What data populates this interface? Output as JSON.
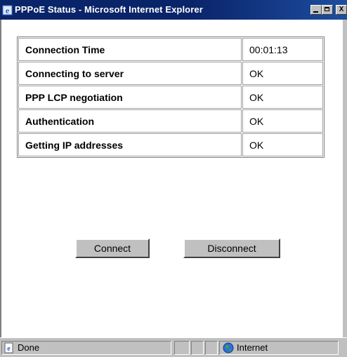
{
  "window": {
    "title": "PPPoE Status - Microsoft Internet Explorer",
    "minimize_icon": "minimize-icon",
    "maximize_icon": "maximize-icon",
    "close_icon": "close-icon",
    "close_glyph": "X"
  },
  "status_table": {
    "rows": [
      {
        "label": "Connection Time",
        "value": "00:01:13"
      },
      {
        "label": "Connecting to server",
        "value": "OK"
      },
      {
        "label": "PPP LCP negotiation",
        "value": "OK"
      },
      {
        "label": "Authentication",
        "value": "OK"
      },
      {
        "label": "Getting IP addresses",
        "value": "OK"
      }
    ]
  },
  "buttons": {
    "connect_label": "Connect",
    "disconnect_label": "Disconnect"
  },
  "statusbar": {
    "status_text": "Done",
    "zone_text": "Internet",
    "page_icon": "ie-page-icon",
    "zone_icon": "globe-icon"
  }
}
